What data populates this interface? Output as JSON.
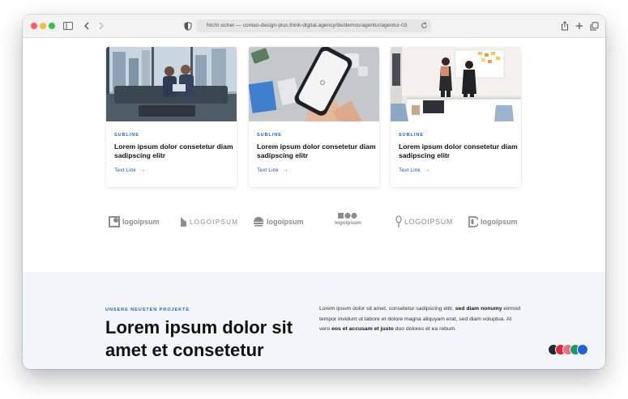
{
  "browser": {
    "url": "Nicht sicher — contao-design-plus.think-digital.agency/de/demos/agentur/agentur-03"
  },
  "cards": [
    {
      "subline": "SUBLINE",
      "title": "Lorem ipsum dolor consetetur diam sadipscing elitr",
      "link": "Text Link"
    },
    {
      "subline": "SUBLINE",
      "title": "Lorem ipsum dolor consetetur diam sadipscing elitr",
      "link": "Text Link"
    },
    {
      "subline": "SUBLINE",
      "title": "Lorem ipsum dolor consetetur diam sadipscing elitr",
      "link": "Text Link"
    }
  ],
  "logos": [
    "logoipsum",
    "LOGOIPSUM",
    "logoipsum",
    "logoipsum",
    "LOGOIPSUM",
    "logoipsum"
  ],
  "projects": {
    "kicker": "UNSERE NEUSTEN PROJEKTE",
    "headline": "Lorem ipsum dolor sit amet et consetetur",
    "para_1": "Lorem ipsum dolor sit amet, consetetur sadipscing elitr, ",
    "para_bold_1": "sed diam nonumy",
    "para_2": " eirmod tempor invidunt ut labore et dolore magna aliquyam erat, sed diam voluptua. At vero ",
    "para_bold_2": "eos et accusam et justo",
    "para_3": " duo dolores et ea rebum."
  },
  "swatch_colors": [
    "#1e2a3a",
    "#e0283c",
    "#f06a8a",
    "#1a9a6a",
    "#1d63e0"
  ]
}
